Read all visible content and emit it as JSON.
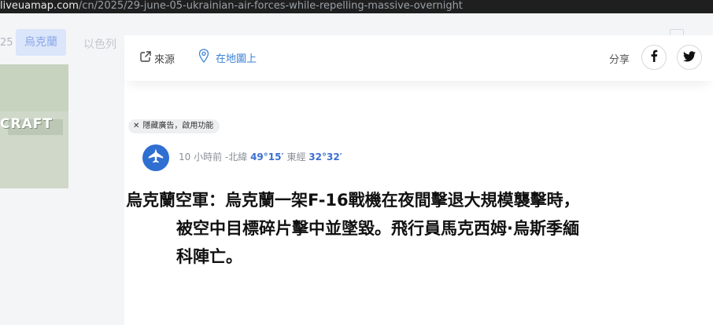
{
  "browser": {
    "url_host": "liveuamap.com",
    "url_path": "/cn/2025/29-june-05-ukrainian-air-forces-while-repelling-massive-overnight"
  },
  "background": {
    "number": "25",
    "chip_active": "烏克蘭",
    "chip_inactive": "以色列",
    "thumbnail_text": "CRAFT"
  },
  "popup": {
    "source_label": "來源",
    "map_label": "在地圖上",
    "share_label": "分享",
    "facebook_icon": "facebook-icon",
    "twitter_icon": "twitter-icon",
    "ad_pill": "隱藏廣告，啟用功能",
    "meta": {
      "time": "10 小時前",
      "separator": " -",
      "lat_label": "北緯 ",
      "lat_value": "49°15′",
      "lon_label": " 東經 ",
      "lon_value": "32°32′"
    },
    "headline_lines": [
      "烏克蘭空軍：烏克蘭一架F-16戰機在夜間擊退大規模襲擊時，",
      "被空中目標碎片擊中並墜毀。飛行員馬克西姆·烏斯季緬",
      "科陣亡。"
    ]
  },
  "colors": {
    "accent": "#3b82d6",
    "avatar": "#2f6fd1",
    "urlbar": "#1f1f1f"
  }
}
